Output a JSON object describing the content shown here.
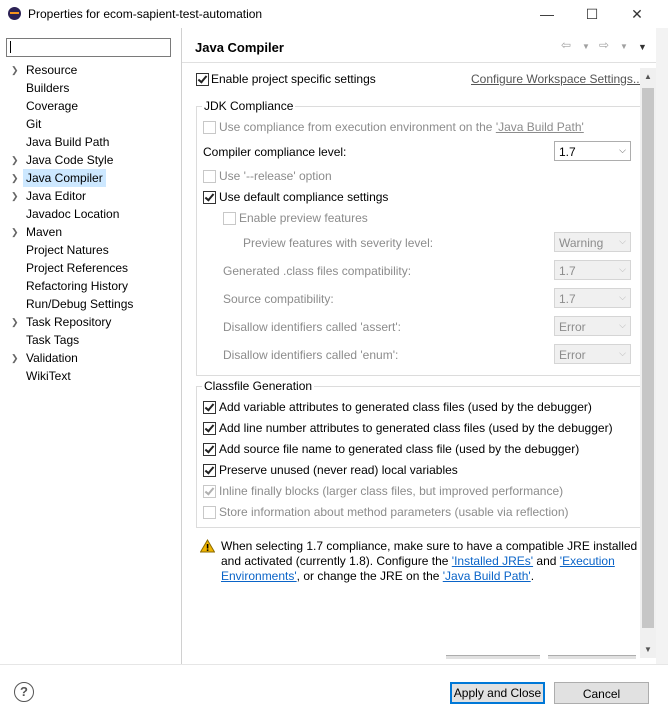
{
  "window": {
    "title": "Properties for ecom-sapient-test-automation",
    "minimize_glyph": "—",
    "maximize_glyph": "☐",
    "close_glyph": "✕"
  },
  "filter": {
    "value": ""
  },
  "nav": {
    "items": [
      {
        "label": "Resource",
        "expandable": true
      },
      {
        "label": "Builders",
        "expandable": false
      },
      {
        "label": "Coverage",
        "expandable": false
      },
      {
        "label": "Git",
        "expandable": false
      },
      {
        "label": "Java Build Path",
        "expandable": false
      },
      {
        "label": "Java Code Style",
        "expandable": true
      },
      {
        "label": "Java Compiler",
        "expandable": true,
        "selected": true
      },
      {
        "label": "Java Editor",
        "expandable": true
      },
      {
        "label": "Javadoc Location",
        "expandable": false
      },
      {
        "label": "Maven",
        "expandable": true
      },
      {
        "label": "Project Natures",
        "expandable": false
      },
      {
        "label": "Project References",
        "expandable": false
      },
      {
        "label": "Refactoring History",
        "expandable": false
      },
      {
        "label": "Run/Debug Settings",
        "expandable": false
      },
      {
        "label": "Task Repository",
        "expandable": true
      },
      {
        "label": "Task Tags",
        "expandable": false
      },
      {
        "label": "Validation",
        "expandable": true
      },
      {
        "label": "WikiText",
        "expandable": false
      }
    ]
  },
  "page": {
    "title": "Java Compiler",
    "enable_specific": "Enable project specific settings",
    "configure_workspace": "Configure Workspace Settings...",
    "jdk": {
      "group_title": "JDK Compliance",
      "use_ee_prefix": "Use compliance from execution environment on the ",
      "use_ee_link": "'Java Build Path'",
      "compliance_level_label": "Compiler compliance level:",
      "compliance_level_value": "1.7",
      "use_release": "Use '--release' option",
      "use_default": "Use default compliance settings",
      "enable_preview": "Enable preview features",
      "preview_severity_label": "Preview features with severity level:",
      "preview_severity_value": "Warning",
      "generated_label": "Generated .class files compatibility:",
      "generated_value": "1.7",
      "source_label": "Source compatibility:",
      "source_value": "1.7",
      "assert_label": "Disallow identifiers called 'assert':",
      "assert_value": "Error",
      "enum_label": "Disallow identifiers called 'enum':",
      "enum_value": "Error"
    },
    "classfile": {
      "group_title": "Classfile Generation",
      "options": [
        {
          "label": "Add variable attributes to generated class files (used by the debugger)",
          "checked": true,
          "enabled": true
        },
        {
          "label": "Add line number attributes to generated class files (used by the debugger)",
          "checked": true,
          "enabled": true
        },
        {
          "label": "Add source file name to generated class file (used by the debugger)",
          "checked": true,
          "enabled": true
        },
        {
          "label": "Preserve unused (never read) local variables",
          "checked": true,
          "enabled": true
        },
        {
          "label": "Inline finally blocks (larger class files, but improved performance)",
          "checked": true,
          "enabled": false
        },
        {
          "label": "Store information about method parameters (usable via reflection)",
          "checked": false,
          "enabled": false
        }
      ]
    },
    "warning": {
      "line1": "When selecting 1.7 compliance, make sure to have a compatible JRE installed",
      "line2_prefix": "and activated (currently 1.8). Configure the ",
      "installed_jres_link": "'Installed JREs'",
      "and_text": " and ",
      "exec_env_link_1": "'Execution",
      "exec_env_link_2": "Environments'",
      "line3_mid": ", or change the JRE on the ",
      "java_build_path_link": "'Java Build Path'",
      "period": "."
    }
  },
  "buttons": {
    "help": "?",
    "apply_close": "Apply and Close",
    "cancel": "Cancel"
  },
  "colors": {
    "selection": "#cde8ff",
    "link": "#0a64c8",
    "accent": "#0078d7",
    "warning": "#f0b400"
  }
}
